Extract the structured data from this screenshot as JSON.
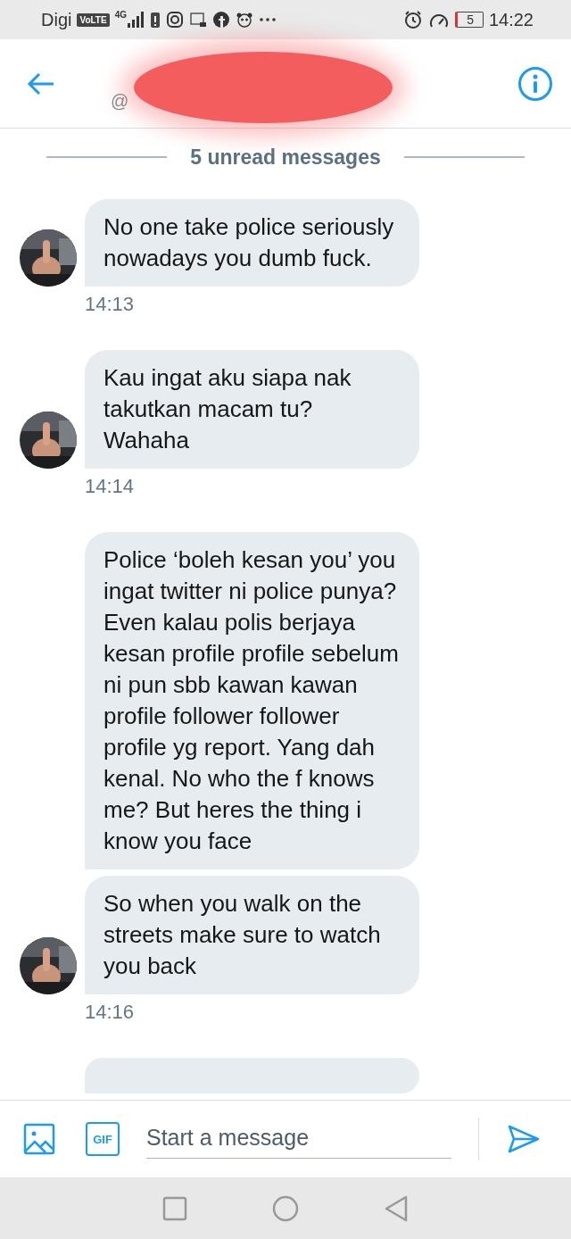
{
  "status_bar": {
    "carrier": "Digi",
    "volte": "VoLTE",
    "network": "4G",
    "battery": "5",
    "time": "14:22"
  },
  "header": {
    "handle": "@",
    "redacted": true
  },
  "unread_divider": "5 unread messages",
  "groups": [
    {
      "bubbles": [
        "No one take police seriously nowadays you dumb fuck."
      ],
      "time": "14:13"
    },
    {
      "bubbles": [
        "Kau ingat aku siapa nak takutkan macam tu? Wahaha"
      ],
      "time": "14:14"
    },
    {
      "bubbles": [
        "Police ‘boleh kesan you’ you ingat twitter ni police punya? Even kalau polis berjaya kesan profile profile sebelum ni pun sbb kawan kawan profile follower follower profile yg report. Yang dah kenal. No who the f knows me? But heres the thing i know you face",
        "So when you walk on the streets make sure to watch you back"
      ],
      "time": "14:16"
    }
  ],
  "composer": {
    "placeholder": "Start a message",
    "gif": "GIF"
  }
}
